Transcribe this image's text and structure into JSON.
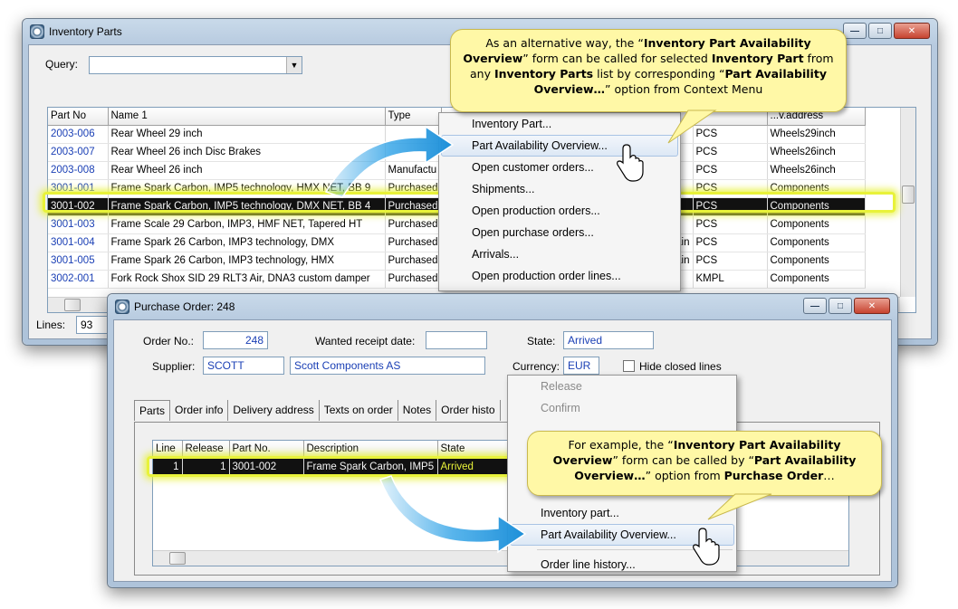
{
  "colors": {
    "accent_arrow": "#3aa7e8",
    "highlight": "#e8f23a",
    "callout_bg": "#fff8a6",
    "link_blue": "#1a3fb5"
  },
  "inventory_window": {
    "title": "Inventory Parts",
    "query_label": "Query:",
    "columns": [
      "Part No",
      "Name 1",
      "Type",
      "",
      "",
      "",
      "",
      "...v.address"
    ],
    "rows": [
      {
        "part_no": "2003-006",
        "name": "Rear Wheel 29 inch",
        "type": "",
        "unit": "PCS",
        "address": "Wheels29inch"
      },
      {
        "part_no": "2003-007",
        "name": "Rear Wheel 26 inch Disc Brakes",
        "type": "",
        "unit": "PCS",
        "address": "Wheels26inch"
      },
      {
        "part_no": "2003-008",
        "name": "Rear Wheel 26 inch",
        "type": "Manufactu",
        "unit": "PCS",
        "address": "Wheels26inch"
      },
      {
        "part_no": "3001-001",
        "name": "Frame Spark Carbon, IMP5 technology, HMX NET, BB 9",
        "type": "Purchased",
        "unit": "PCS",
        "address": "Components"
      },
      {
        "part_no": "3001-002",
        "name": "Frame Spark Carbon, IMP5 technology, DMX NET, BB 4",
        "type": "Purchased",
        "unit": "PCS",
        "address": "Components"
      },
      {
        "part_no": "3001-003",
        "name": "Frame Scale 29 Carbon, IMP3, HMF NET, Tapered HT",
        "type": "Purchased",
        "unit": "PCS",
        "address": "Components"
      },
      {
        "part_no": "3001-004",
        "name": "Frame Spark 26 Carbon, IMP3 technology, DMX",
        "type": "Purchased",
        "extra": "ain",
        "unit": "PCS",
        "address": "Components"
      },
      {
        "part_no": "3001-005",
        "name": "Frame Spark 26 Carbon, IMP3 technology, HMX",
        "type": "Purchased",
        "extra": "ain",
        "unit": "PCS",
        "address": "Components"
      },
      {
        "part_no": "3002-001",
        "name": "Fork Rock Shox SID 29 RLT3 Air, DNA3 custom damper",
        "type": "Purchased",
        "unit": "KMPL",
        "address": "Components"
      }
    ],
    "lines_label": "Lines:",
    "lines_value": "93"
  },
  "inventory_context_menu": [
    "Inventory Part...",
    "Part Availability Overview...",
    "Open customer orders...",
    "Shipments...",
    "Open production orders...",
    "Open purchase orders...",
    "Arrivals...",
    "Open production order lines..."
  ],
  "callout_top": {
    "t1": "As an alternative way, the “",
    "b1": "Inventory Part Availability Overview",
    "t2": "” form can be called for selected ",
    "b2": "Inventory Part",
    "t3": " from any ",
    "b3": "Inventory Parts",
    "t4": " list by corresponding “",
    "b4": "Part Availability Overview…",
    "t5": "” option from Context Menu"
  },
  "po_window": {
    "title": "Purchase Order: 248",
    "order_no_label": "Order No.:",
    "order_no": "248",
    "wanted_label": "Wanted receipt date:",
    "wanted_value": "",
    "state_label": "State:",
    "state_value": "Arrived",
    "supplier_label": "Supplier:",
    "supplier_id": "SCOTT",
    "supplier_name": "Scott Components AS",
    "currency_label": "Currency:",
    "currency_value": "EUR",
    "hide_closed_label": "Hide closed lines",
    "tabs": [
      "Parts",
      "Order info",
      "Delivery address",
      "Texts on order",
      "Notes",
      "Order histo"
    ],
    "line_columns": [
      "Line",
      "Release",
      "Part No.",
      "Description",
      "State"
    ],
    "line_row": {
      "line": "1",
      "release": "1",
      "part_no": "3001-002",
      "description": "Frame Spark Carbon, IMP5",
      "state": "Arrived"
    }
  },
  "po_context_menu": {
    "disabled": [
      "Release",
      "Confirm"
    ],
    "items": [
      "Inventory part...",
      "Part Availability Overview...",
      "Order line history..."
    ]
  },
  "callout_bottom": {
    "t1": "For example, the “",
    "b1": "Inventory Part Availability Overview",
    "t2": "” form can be called by “",
    "b2": "Part Availability Overview…",
    "t3": "” option from ",
    "b3": "Purchase Order",
    "t4": "…"
  }
}
